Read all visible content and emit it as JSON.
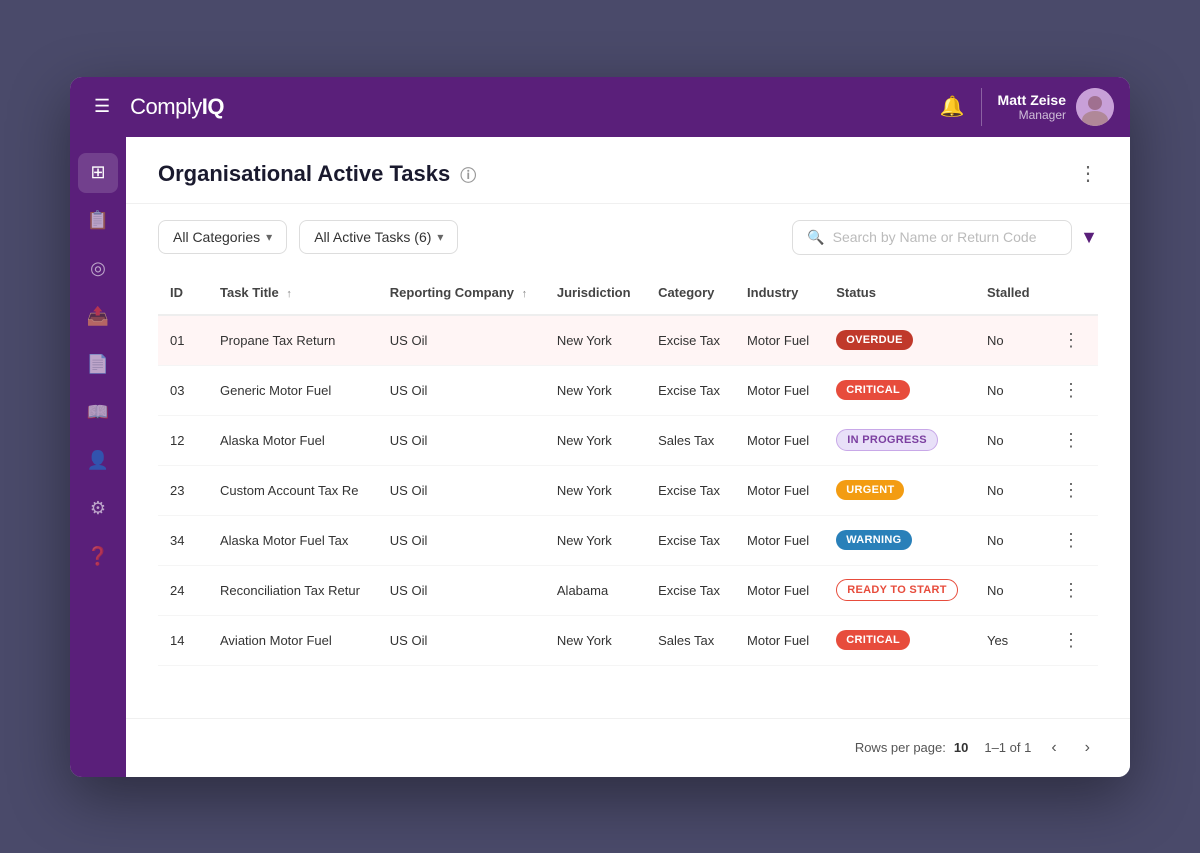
{
  "app": {
    "name": "ComplyIQ",
    "logo_text": "Comply",
    "logo_bold": "IQ"
  },
  "top_nav": {
    "hamburger_label": "☰",
    "notification_icon": "🔔",
    "user": {
      "name": "Matt Zeise",
      "role": "Manager",
      "avatar_emoji": "👤"
    }
  },
  "sidebar": {
    "items": [
      {
        "icon": "⊞",
        "name": "dashboard"
      },
      {
        "icon": "📋",
        "name": "tasks"
      },
      {
        "icon": "◎",
        "name": "compliance"
      },
      {
        "icon": "📤",
        "name": "reports"
      },
      {
        "icon": "📄",
        "name": "documents"
      },
      {
        "icon": "📖",
        "name": "library"
      },
      {
        "icon": "👤",
        "name": "users"
      },
      {
        "icon": "⚙",
        "name": "settings"
      },
      {
        "icon": "❓",
        "name": "help"
      }
    ]
  },
  "page": {
    "title": "Organisational Active Tasks",
    "info_icon": "ⓘ"
  },
  "filters": {
    "categories_label": "All Categories",
    "tasks_label": "All Active Tasks (6)",
    "search_placeholder": "Search by Name or Return Code"
  },
  "table": {
    "columns": [
      "ID",
      "Task Title",
      "Reporting Company",
      "Jurisdiction",
      "Category",
      "Industry",
      "Status",
      "Stalled"
    ],
    "rows": [
      {
        "id": "01",
        "task": "Propane Tax Return",
        "company": "US Oil",
        "jurisdiction": "New York",
        "category": "Excise Tax",
        "industry": "Motor Fuel",
        "status": "OVERDUE",
        "stalled": "No",
        "highlighted": true,
        "badge_class": "badge-overdue"
      },
      {
        "id": "03",
        "task": "Generic Motor Fuel",
        "company": "US Oil",
        "jurisdiction": "New York",
        "category": "Excise Tax",
        "industry": "Motor Fuel",
        "status": "CRITICAL",
        "stalled": "No",
        "highlighted": false,
        "badge_class": "badge-critical"
      },
      {
        "id": "12",
        "task": "Alaska Motor Fuel",
        "company": "US Oil",
        "jurisdiction": "New York",
        "category": "Sales Tax",
        "industry": "Motor Fuel",
        "status": "IN PROGRESS",
        "stalled": "No",
        "highlighted": false,
        "badge_class": "badge-in-progress"
      },
      {
        "id": "23",
        "task": "Custom Account Tax  Re",
        "company": "US Oil",
        "jurisdiction": "New York",
        "category": "Excise Tax",
        "industry": "Motor Fuel",
        "status": "URGENT",
        "stalled": "No",
        "highlighted": false,
        "badge_class": "badge-urgent"
      },
      {
        "id": "34",
        "task": "Alaska Motor Fuel Tax",
        "company": "US Oil",
        "jurisdiction": "New York",
        "category": "Excise Tax",
        "industry": "Motor Fuel",
        "status": "WARNING",
        "stalled": "No",
        "highlighted": false,
        "badge_class": "badge-warning"
      },
      {
        "id": "24",
        "task": "Reconciliation Tax Retur",
        "company": "US Oil",
        "jurisdiction": "Alabama",
        "category": "Excise Tax",
        "industry": "Motor Fuel",
        "status": "READY TO START",
        "stalled": "No",
        "highlighted": false,
        "badge_class": "badge-ready"
      },
      {
        "id": "14",
        "task": "Aviation Motor Fuel",
        "company": "US Oil",
        "jurisdiction": "New York",
        "category": "Sales Tax",
        "industry": "Motor Fuel",
        "status": "CRITICAL",
        "stalled": "Yes",
        "highlighted": false,
        "badge_class": "badge-critical"
      }
    ]
  },
  "pagination": {
    "rows_per_page_label": "Rows per page:",
    "rows_per_page_value": "10",
    "page_range": "1–1 of 1"
  }
}
